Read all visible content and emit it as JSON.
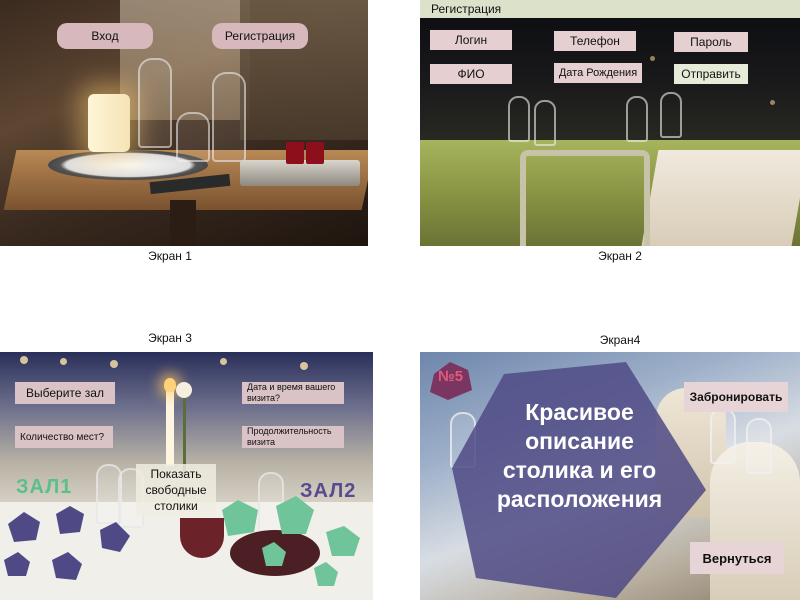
{
  "screens": {
    "screen1": {
      "caption": "Экран 1",
      "login_button": "Вход",
      "register_button": "Регистрация"
    },
    "screen2": {
      "caption": "Экран 2",
      "header_title": "Регистрация",
      "login_field": "Логин",
      "phone_field": "Телефон",
      "password_field": "Пароль",
      "fio_field": "ФИО",
      "birthdate_field": "Дата Рождения",
      "submit_button": "Отправить"
    },
    "screen3": {
      "caption": "Экран 3",
      "choose_hall": "Выберите зал",
      "seats_count": "Количество мест?",
      "visit_datetime": "Дата и время вашего визита?",
      "visit_duration": "Продолжительность визита",
      "show_free_tables": "Показать свободные столики",
      "hall1_label": "ЗАЛ1",
      "hall2_label": "ЗАЛ2"
    },
    "screen4": {
      "caption": "Экран4",
      "table_number": "№5",
      "table_description": "Красивое описание столика и его расположения",
      "book_button": "Забронировать",
      "back_button": "Вернуться"
    }
  },
  "colors": {
    "button_rose": "#d7b8bc",
    "header_green": "#dbe2c9",
    "hall1_green": "#5bbf8a",
    "hall2_purple": "#5b4a8f",
    "table_polygon": "#4f4a85",
    "number_badge": "#7a3560"
  }
}
